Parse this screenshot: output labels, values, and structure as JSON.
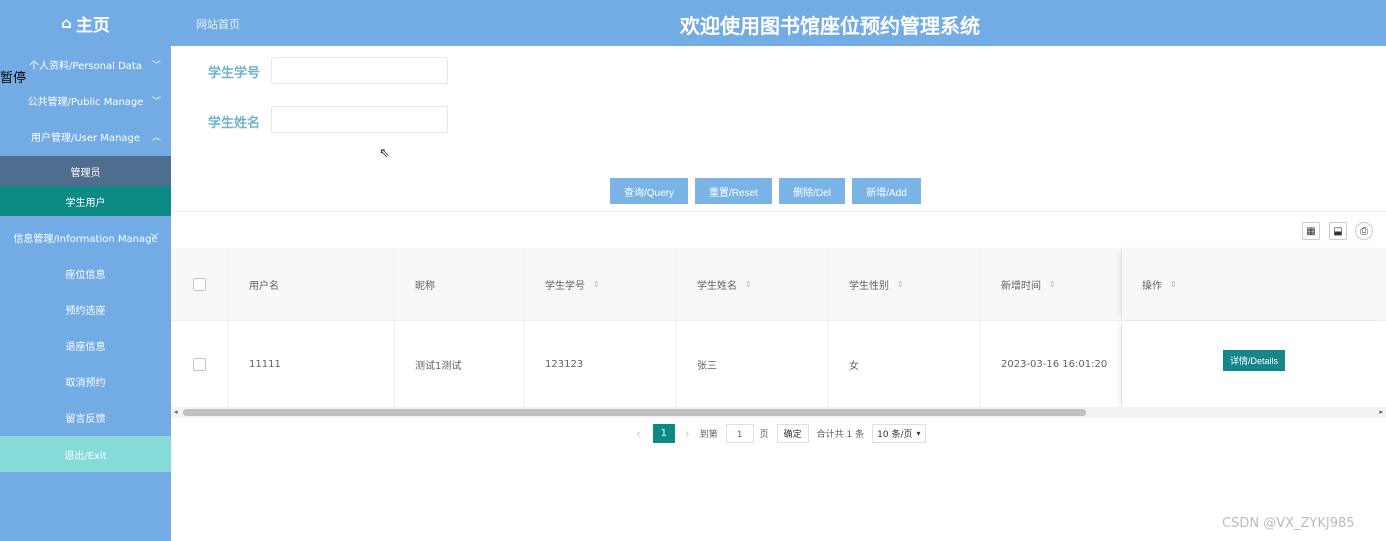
{
  "header": {
    "brand": "主页",
    "site_home": "网站首页",
    "title": "欢迎使用图书馆座位预约管理系统"
  },
  "sidebar": {
    "overlay": "暂停",
    "items": [
      {
        "label": "个人资料/Personal Data"
      },
      {
        "label": "公共管理/Public Manage"
      },
      {
        "label": "用户管理/User Manage"
      },
      {
        "label": "管理员"
      },
      {
        "label": "学生用户"
      },
      {
        "label": "信息管理/Information Manage"
      },
      {
        "label": "座位信息"
      },
      {
        "label": "预约选座"
      },
      {
        "label": "退座信息"
      },
      {
        "label": "取消预约"
      },
      {
        "label": "留言反馈"
      },
      {
        "label": "退出/Exit"
      }
    ]
  },
  "search": {
    "student_no_label": "学生学号",
    "student_name_label": "学生姓名",
    "student_no_value": "",
    "student_name_value": ""
  },
  "buttons": {
    "query": "查询/Query",
    "reset": "重置/Reset",
    "delete": "删除/Del",
    "add": "新增/Add"
  },
  "table": {
    "headers": [
      "用户名",
      "昵称",
      "学生学号",
      "学生姓名",
      "学生性别",
      "新增时间",
      "操作"
    ],
    "rows": [
      {
        "username": "11111",
        "nickname": "测试1测试",
        "student_no": "123123",
        "student_name": "张三",
        "gender": "女",
        "created": "2023-03-16 16:01:20",
        "details": "详情/Details"
      }
    ]
  },
  "pagination": {
    "current": "1",
    "goto_label": "到第",
    "goto_value": "1",
    "page_unit": "页",
    "confirm": "确定",
    "total": "合计共 1 条",
    "page_size": "10 条/页"
  },
  "watermark": "CSDN @VX_ZYKJ985",
  "colors": {
    "header_bg": "#73ace4",
    "active_menu": "#0e8a84",
    "button_bg": "#7ab4e6"
  }
}
